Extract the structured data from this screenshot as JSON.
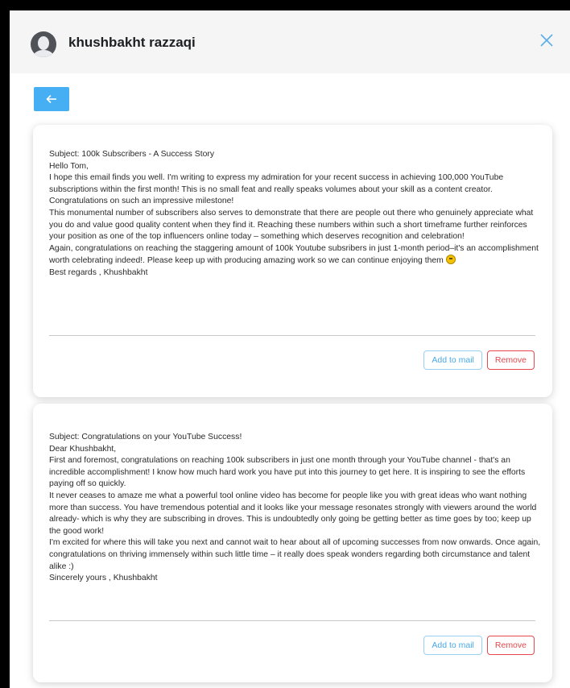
{
  "header": {
    "user_name": "khushbakht razzaqi",
    "avatar_icon": "user-avatar-icon",
    "close_icon": "close-icon"
  },
  "back_button": {
    "icon": "arrow-left-icon",
    "label": "←"
  },
  "colors": {
    "accent": "#46aef2",
    "remove": "#e5484d",
    "header_bg": "#f5f5f6"
  },
  "emails": [
    {
      "lines": [
        "Subject: 100k Subscribers - A Success Story",
        "Hello Tom,",
        "I hope this email finds you well. I'm writing to express my admiration for your recent success in achieving 100,000 YouTube subscriptions within the first month! This is no small feat and really speaks volumes about your skill as a content creator. Congratulations on such an impressive milestone!",
        "This monumental number of subscribers also serves to demonstrate that there are people out there who genuinely appreciate what you do and value good quality content when they find it. Reaching these numbers within such a short timeframe further reinforces your position as one of the top influencers online today – something which deserves recognition and celebration!",
        "Again, congratulations on reaching the staggering amount of 100k Youtube subsribers in just 1-month period–it's an accomplishment worth celebrating indeed!. Please keep up with producing amazing work so we can continue enjoying them",
        "Best regards , Khushbakht"
      ],
      "add_label": "Add to mail",
      "remove_label": "Remove"
    },
    {
      "lines": [
        "Subject: Congratulations on your YouTube Success!",
        "Dear Khushbakht,",
        "First and foremost, congratulations on reaching 100k subscribers in just one month through your YouTube channel - that's an incredible accomplishment! I know how much hard work you have put into this journey to get here. It is inspiring to see the efforts paying off so quickly.",
        "It never ceases to amaze me what a powerful tool online video has become for people like you with great ideas who want nothing more than success. You have tremendous potential and it looks like your message resonates strongly with viewers around the world already- which is why they are subscribing in droves. This is undoubtedly only going be getting better as time goes by too; keep up the good work!",
        "I'm excited for where this will take you next and cannot wait to hear about all of upcoming successes from now onwards. Once again, congratulations on thriving immensely within such little time – it really does speak wonders regarding both circumstance and talent alike :)",
        "Sincerely yours , Khushbakht"
      ],
      "add_label": "Add to mail",
      "remove_label": "Remove"
    }
  ]
}
